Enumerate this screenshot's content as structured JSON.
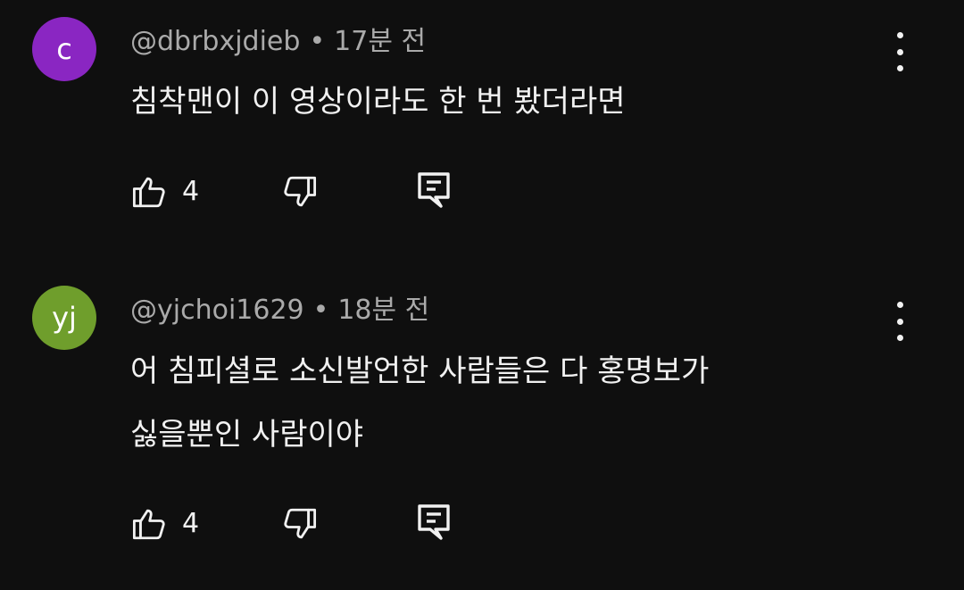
{
  "comments": [
    {
      "avatar_letter": "c",
      "avatar_color": "#8a26c2",
      "author": "@dbrbxjdieb",
      "time": "17분 전",
      "lines": [
        "침착맨이 이 영상이라도 한 번 봤더라면"
      ],
      "like_count": "4"
    },
    {
      "avatar_letter": "yj",
      "avatar_color": "#6f9e2c",
      "author": "@yjchoi1629",
      "time": "18분 전",
      "lines": [
        "어 침피셜로 소신발언한 사람들은 다 홍명보가",
        "싫을뿐인 사람이야"
      ],
      "like_count": "4"
    }
  ],
  "separator": "•",
  "icons": {
    "like": "thumbs-up-icon",
    "dislike": "thumbs-down-icon",
    "reply": "reply-icon",
    "more": "more-vert-icon"
  }
}
